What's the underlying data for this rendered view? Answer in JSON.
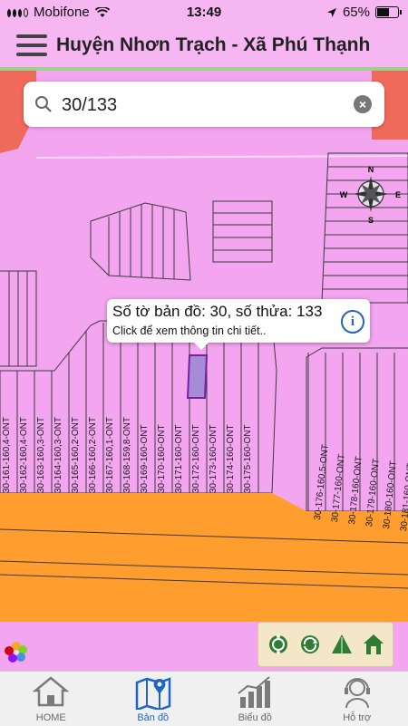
{
  "status_bar": {
    "carrier": "Mobifone",
    "time": "13:49",
    "battery": "65%",
    "battery_level": 0.65
  },
  "app_bar": {
    "title": "Huyện Nhơn Trạch - Xã Phú Thạnh"
  },
  "search": {
    "value": "30/133"
  },
  "popup": {
    "line1": "Số tờ bản đồ: 30, số thửa: 133",
    "line2": "Click để xem thông tin chi tiết.."
  },
  "parcels_left": [
    "30-161-160,4-ONT",
    "30-162-160,4-ONT",
    "30-163-160,3-ONT",
    "30-164-160,3-ONT",
    "30-165-160,2-ONT",
    "30-166-160,2-ONT",
    "30-167-160,1-ONT",
    "30-168-159,8-ONT",
    "30-169-160-ONT",
    "30-170-160-ONT",
    "30-171-160-ONT",
    "30-172-160-ONT",
    "30-173-160-ONT",
    "30-174-160-ONT",
    "30-175-160-ONT"
  ],
  "parcels_right": [
    "30-176-160,5-ONT",
    "30-177-160-ONT",
    "30-178-160-ONT",
    "30-179-160-ONT",
    "30-180-160-ONT",
    "30-181-160-ONT",
    "30-182-16"
  ],
  "compass_labels": {
    "n": "N",
    "e": "E",
    "w": "W",
    "s": "S"
  },
  "tools": [
    "measure-icon",
    "refresh-icon",
    "triangle-icon",
    "home-icon"
  ],
  "tabs": [
    {
      "label": "HOME",
      "icon": "home-icon",
      "active": false
    },
    {
      "label": "Bản đồ",
      "icon": "map-pin-icon",
      "active": true
    },
    {
      "label": "Biểu đồ",
      "icon": "bar-chart-icon",
      "active": false
    },
    {
      "label": "Hỗ trợ",
      "icon": "support-agent-icon",
      "active": false
    }
  ],
  "colors": {
    "residential": "#f3a5f0",
    "road": "#ff9e2e",
    "commercial": "#f06a5c",
    "selected_parcel": "#a68bd6",
    "accent": "#1d65c7"
  }
}
